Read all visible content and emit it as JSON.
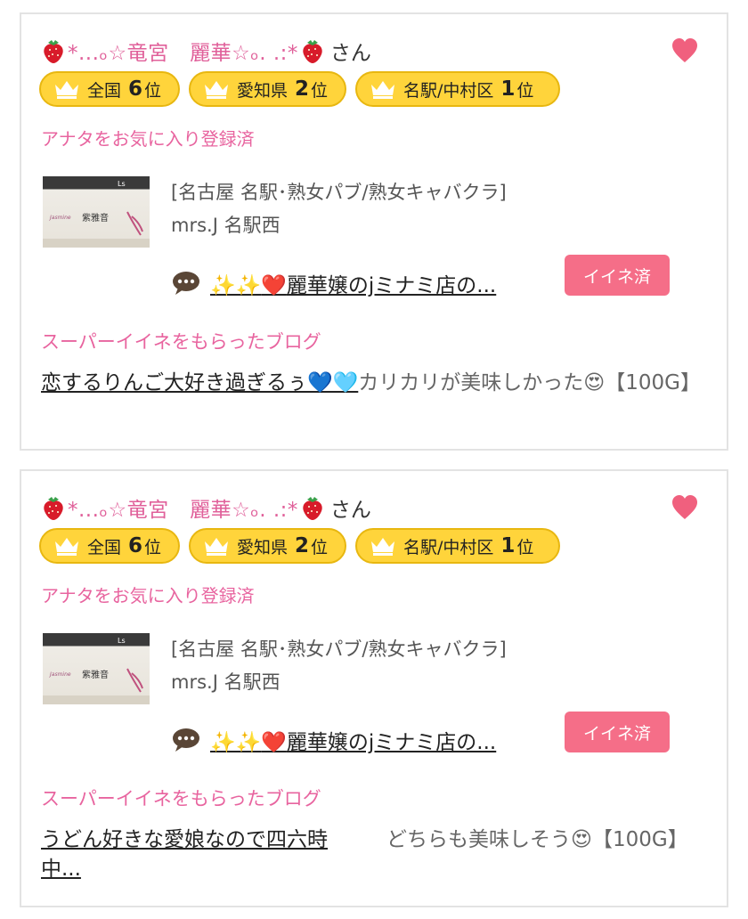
{
  "colors": {
    "pink": "#e8649f",
    "gold": "#ffd43b",
    "button": "#f56e88"
  },
  "icons": [
    "strawberry-icon",
    "heart-icon",
    "crown-icon",
    "speech-bubble-icon"
  ],
  "cards": [
    {
      "user_name": "*...ₒ☆竜宮　麗華☆ₒ. .:*",
      "san": "さん",
      "ranks": [
        {
          "label": "全国",
          "num": "6",
          "suffix": "位"
        },
        {
          "label": "愛知県",
          "num": "2",
          "suffix": "位"
        },
        {
          "label": "名駅/中村区",
          "num": "1",
          "suffix": "位"
        }
      ],
      "favorite_status": "アナタをお気に入り登録済",
      "shop_category": "[名古屋 名駅･熟女パブ/熟女キャバクラ]",
      "shop_name": "mrs.J 名駅西",
      "blog_sparkles": "✨✨",
      "blog_heart": "❤️",
      "blog_title": "麗華嬢のjミナミ店の...",
      "iine_label": "イイネ済",
      "super_heading": "スーパーイイネをもらったブログ",
      "post_link": "恋するりんご大好き過ぎるぅ💙🩵",
      "post_text": "カリカリが美味しかった😍【100G】"
    },
    {
      "user_name": "*...ₒ☆竜宮　麗華☆ₒ. .:*",
      "san": "さん",
      "ranks": [
        {
          "label": "全国",
          "num": "6",
          "suffix": "位"
        },
        {
          "label": "愛知県",
          "num": "2",
          "suffix": "位"
        },
        {
          "label": "名駅/中村区",
          "num": "1",
          "suffix": "位"
        }
      ],
      "favorite_status": "アナタをお気に入り登録済",
      "shop_category": "[名古屋 名駅･熟女パブ/熟女キャバクラ]",
      "shop_name": "mrs.J 名駅西",
      "blog_sparkles": "✨✨",
      "blog_heart": "❤️",
      "blog_title": "麗華嬢のjミナミ店の...",
      "iine_label": "イイネ済",
      "super_heading": "スーパーイイネをもらったブログ",
      "post_link": "うどん好きな愛娘なので四六時中...",
      "post_text": "どちらも美味しそう😍【100G】"
    }
  ]
}
